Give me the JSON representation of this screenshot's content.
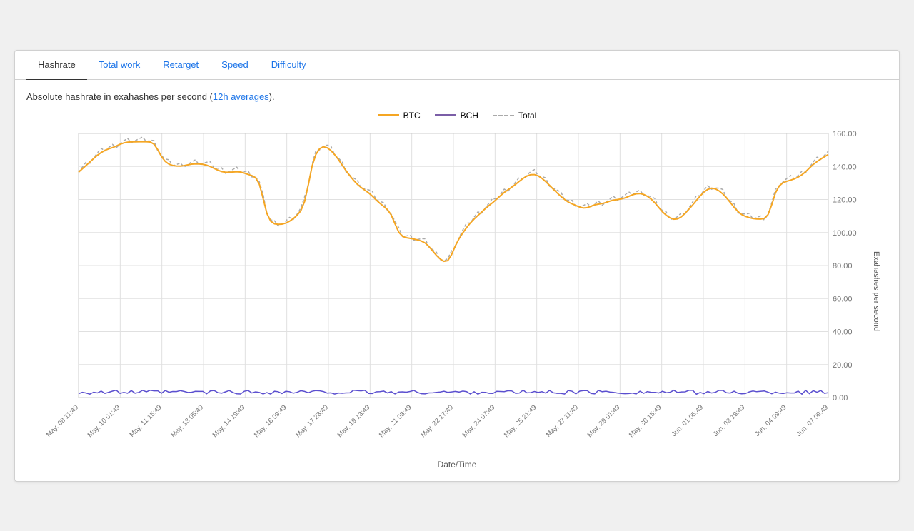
{
  "tabs": [
    {
      "label": "Hashrate",
      "active": true
    },
    {
      "label": "Total work",
      "active": false
    },
    {
      "label": "Retarget",
      "active": false
    },
    {
      "label": "Speed",
      "active": false
    },
    {
      "label": "Difficulty",
      "active": false
    }
  ],
  "description": "Absolute hashrate in exahashes per second (",
  "description_link": "12h averages",
  "description_end": ").",
  "legend": [
    {
      "label": "BTC",
      "type": "btc"
    },
    {
      "label": "BCH",
      "type": "bch"
    },
    {
      "label": "Total",
      "type": "total"
    }
  ],
  "y_axis_label": "Exahashes per second",
  "x_axis_title": "Date/Time",
  "x_ticks": [
    "May, 08 11:49",
    "May, 10 01:49",
    "May, 11 15:49",
    "May, 13 05:49",
    "May, 14 19:49",
    "May, 16 09:49",
    "May, 17 23:49",
    "May, 19 13:49",
    "May, 21 03:49",
    "May, 22 17:49",
    "May, 24 07:49",
    "May, 25 21:49",
    "May, 27 11:49",
    "May, 29 01:49",
    "May, 30 15:49",
    "Jun, 01 05:49",
    "Jun, 02 19:49",
    "Jun, 04 09:49",
    "Jun, 07 09:49"
  ],
  "y_ticks": [
    "0.00",
    "20.00",
    "40.00",
    "60.00",
    "80.00",
    "100.00",
    "120.00",
    "140.00",
    "160.00"
  ],
  "colors": {
    "btc": "#f5a623",
    "bch": "#5b4fcf",
    "total": "#aaaaaa",
    "grid": "#e8e8e8",
    "axis": "#999"
  }
}
